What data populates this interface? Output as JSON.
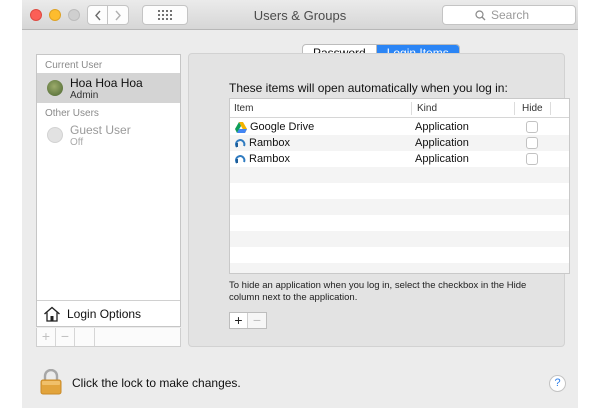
{
  "window": {
    "title": "Users & Groups",
    "search_placeholder": "Search"
  },
  "sidebar": {
    "current_user_heading": "Current User",
    "current_user": {
      "name": "Hoa Hoa Hoa",
      "role": "Admin"
    },
    "other_users_heading": "Other Users",
    "other_users": [
      {
        "name": "Guest User",
        "status": "Off"
      }
    ],
    "login_options_label": "Login Options",
    "add_label": "+",
    "remove_label": "−"
  },
  "tabs": [
    {
      "label": "Password",
      "selected": false
    },
    {
      "label": "Login Items",
      "selected": true
    }
  ],
  "login_items": {
    "heading": "These items will open automatically when you log in:",
    "columns": {
      "item": "Item",
      "kind": "Kind",
      "hide": "Hide"
    },
    "rows": [
      {
        "name": "Google Drive",
        "kind": "Application",
        "icon": "google-drive-icon",
        "hide": false
      },
      {
        "name": "Rambox",
        "kind": "Application",
        "icon": "rambox-icon",
        "hide": false
      },
      {
        "name": "Rambox",
        "kind": "Application",
        "icon": "rambox-icon",
        "hide": false
      }
    ],
    "hint": "To hide an application when you log in, select the checkbox in the Hide column next to the application.",
    "add_label": "+",
    "remove_label": "−"
  },
  "footer": {
    "lock_text": "Click the lock to make changes.",
    "help_label": "?"
  },
  "colors": {
    "accent": "#2b85f5",
    "close": "#fc5f57",
    "minimize": "#fdbc2e",
    "lock": "#e2a43c"
  }
}
